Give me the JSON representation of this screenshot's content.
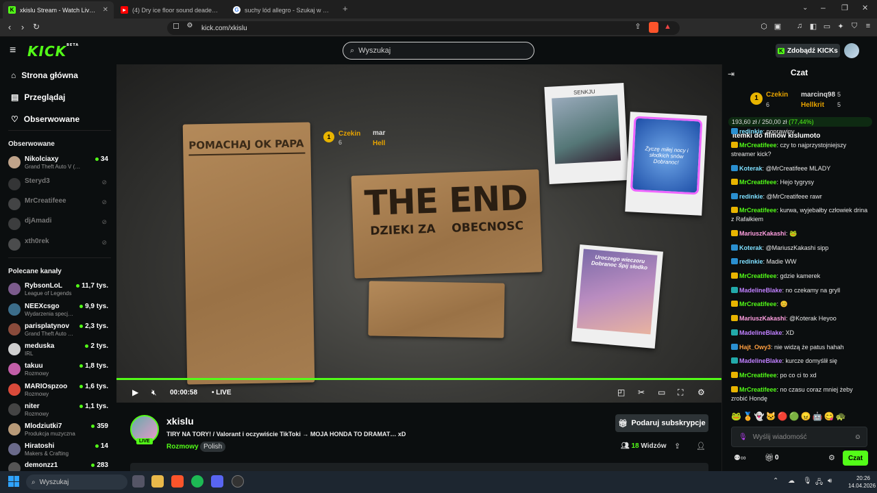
{
  "browser": {
    "tabs": [
      {
        "label": "xkislu Stream - Watch Live on Ki…",
        "active": true
      },
      {
        "label": "(4) Dry ice floor sound deadener rem…",
        "active": false
      },
      {
        "label": "suchy lód allegro - Szukaj w Google",
        "active": false
      }
    ],
    "url": "kick.com/xkislu"
  },
  "header": {
    "logo": "KICK",
    "logo_badge": "BETA",
    "search_placeholder": "Wyszukaj",
    "kicks_button": "Zdobądź KICKs"
  },
  "sidebar": {
    "nav": [
      {
        "label": "Strona główna",
        "icon": "home-icon"
      },
      {
        "label": "Przeglądaj",
        "icon": "browse-icon"
      },
      {
        "label": "Obserwowane",
        "icon": "heart-icon"
      }
    ],
    "followed_title": "Obserwowane",
    "followed": [
      {
        "name": "Nikolciaxy",
        "category": "Grand Theft Auto V (GTA)",
        "viewers": "34",
        "online": true
      },
      {
        "name": "Steryd3",
        "online": false
      },
      {
        "name": "MrCreatifeee",
        "online": false
      },
      {
        "name": "djAmadi",
        "online": false
      },
      {
        "name": "xth0rek",
        "online": false
      }
    ],
    "recommended_title": "Polecane kanały",
    "recommended": [
      {
        "name": "RybsonLoL",
        "category": "League of Legends",
        "viewers": "11,7 tys."
      },
      {
        "name": "NEEXcsgo",
        "category": "Wydarzenia specj…",
        "viewers": "9,9 tys."
      },
      {
        "name": "parisplatynov",
        "category": "Grand Theft Auto …",
        "viewers": "2,3 tys."
      },
      {
        "name": "meduska",
        "category": "IRL",
        "viewers": "2 tys."
      },
      {
        "name": "takuu",
        "category": "Rozmowy",
        "viewers": "1,8 tys."
      },
      {
        "name": "MARIOspzoo",
        "category": "Rozmowy",
        "viewers": "1,6 tys."
      },
      {
        "name": "niter",
        "category": "Rozmowy",
        "viewers": "1,1 tys."
      },
      {
        "name": "Mlodziutki7",
        "category": "Produkcja muzyczna",
        "viewers": "359"
      },
      {
        "name": "Hiratoshi",
        "category": "Makers & Crafting",
        "viewers": "14"
      },
      {
        "name": "demonzz1",
        "category": "",
        "viewers": "283"
      }
    ]
  },
  "video": {
    "sign_left": "POMACHAJ OK PAPA",
    "sign_main": "THE END",
    "sign_sub": "DZIEKI ZA    OBECNOSC",
    "photo1_caption": "SENKJU",
    "photo2_text": "Życzę miłej nocy i słodkich snów Dobranoc!",
    "photo3_text": "Uroczego wieczoru Dobranoc Śpij słodko",
    "overlay_user1": "Czekin",
    "overlay_user1_count": "6",
    "overlay_user2": "mar",
    "overlay_user3": "Hell",
    "time": "00:00:58",
    "live_label": "LIVE"
  },
  "stream": {
    "channel": "xkislu",
    "live_badge": "LIVE",
    "title": "TIRY NA TORY! / Valorant i oczywiście TikToki → MOJA HONDA TO DRAMAT… xD",
    "category": "Rozmowy",
    "language": "Polish",
    "sub_button": "Podaruj subskrypcje",
    "viewers": "18",
    "viewers_label": "Widzów"
  },
  "chat": {
    "title": "Czat",
    "leaderboard": [
      {
        "rank": "1",
        "name": "Czekin",
        "count": "6"
      },
      {
        "name": "marcinq98",
        "count": "5"
      },
      {
        "name": "Hellkrit",
        "count": "5"
      }
    ],
    "goal_current": "193,60 zł",
    "goal_sep": "/",
    "goal_target": "250,00 zł",
    "goal_pct": "(77,44%)",
    "pinned": "itemki do filmów kislumoto",
    "messages": [
      {
        "user": "redinkie",
        "text": "poprawiny",
        "color": "#7fe0ff"
      },
      {
        "user": "MrCreatifeee",
        "text": "czy to najprzystojniejszy streamer kick?",
        "color": "#53fc18"
      },
      {
        "user": "Koterak",
        "text": "@MrCreatifeee MLADY",
        "color": "#7fe0ff"
      },
      {
        "user": "MrCreatifeee",
        "text": "Hejo tygrysy",
        "color": "#53fc18"
      },
      {
        "user": "redinkie",
        "text": "@MrCreatifeee rawr",
        "color": "#7fe0ff"
      },
      {
        "user": "MrCreatifeee",
        "text": "kurwa, wyjebałby człowiek drina z Rafałkiem",
        "color": "#53fc18"
      },
      {
        "user": "MariuszKakashi",
        "text": "🐸",
        "color": "#ff9fe0"
      },
      {
        "user": "Koterak",
        "text": "@MariuszKakashi sipp",
        "color": "#7fe0ff"
      },
      {
        "user": "redinkie",
        "text": "Madie WW",
        "color": "#7fe0ff"
      },
      {
        "user": "MrCreatifeee",
        "text": "gdzie kamerek",
        "color": "#53fc18"
      },
      {
        "user": "MadelineBlake",
        "text": "no czekamy na gryll",
        "color": "#c080ff"
      },
      {
        "user": "MrCreatifeee",
        "text": "😊",
        "color": "#53fc18"
      },
      {
        "user": "MariuszKakashi",
        "text": "@Koterak Heyoo",
        "color": "#ff9fe0"
      },
      {
        "user": "MadelineBlake",
        "text": "XD",
        "color": "#c080ff"
      },
      {
        "user": "Hajt_Owy3",
        "text": "nie widzą że patus hahah",
        "color": "#ff9f40"
      },
      {
        "user": "MadelineBlake",
        "text": "kurcze domyślił się",
        "color": "#c080ff"
      },
      {
        "user": "MrCreatifeee",
        "text": "po co ci to xd",
        "color": "#53fc18"
      },
      {
        "user": "MrCreatifeee",
        "text": "no czasu coraz mniej żeby zrobić Hondę",
        "color": "#53fc18"
      }
    ],
    "input_placeholder": "Wyślij wiadomość",
    "points": "0",
    "send_button": "Czat"
  },
  "taskbar": {
    "search": "Wyszukaj",
    "time": "20:26",
    "date": "14.04.2026"
  }
}
